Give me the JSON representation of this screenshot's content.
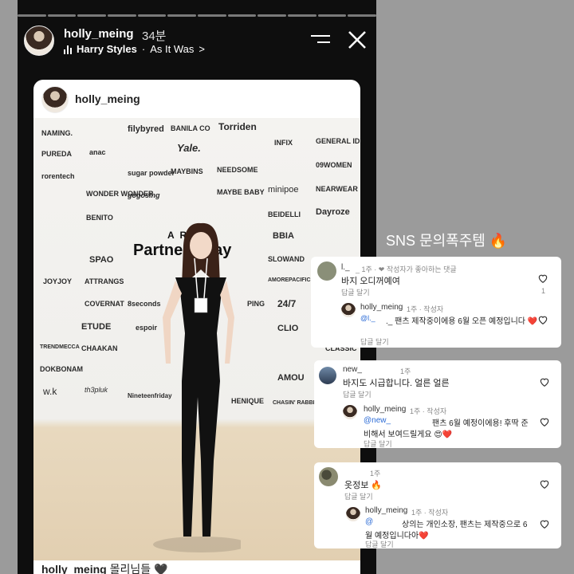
{
  "story": {
    "username": "holly_meing",
    "time": "34분",
    "music_artist": "Harry Styles",
    "music_sep": "·",
    "music_track": "As It Was",
    "music_chevron": ">"
  },
  "post": {
    "username": "holly_meing",
    "caption_user": "holly_meing",
    "caption_text": "몰리님들 🖤",
    "backdrop_title": "A RBY",
    "backdrop_main": "Partners Day",
    "logos": [
      "NAMING.",
      "filybyred",
      "BANILA CO",
      "Torriden",
      "GENERAL IDEA",
      "PUREDA",
      "anac",
      "Yale.",
      "INFIX",
      "rorentech",
      "sugar powder",
      "MAYBINS",
      "NEEDSOME",
      "09WOMEN",
      "WONDER WONDER",
      "gogosing",
      "MAYBE BABY",
      "minipoe",
      "NEARWEAR",
      "BENITO",
      "BEIDELLI",
      "Dayroze",
      "BBIA",
      "SPAO",
      "SLOWAND",
      "JOYJOY",
      "ATTRANGS",
      "AMOREPACIFIC",
      "COVERNAT",
      "8seconds",
      "PING",
      "24/7",
      "ETUDE",
      "espoir",
      "CLIO",
      "TRENDMECCA",
      "CHAAKAN",
      "CLASSIC",
      "DOKBONAM",
      "AMOU",
      "w.k",
      "th3pluk",
      "Nineteenfriday",
      "HENIQUE",
      "CHASIN' RABBITS"
    ]
  },
  "sns": {
    "title": "SNS 문의폭주템 🔥",
    "threads": [
      {
        "user": "l._",
        "extra": "_ 1주 · ❤ 작성자가 좋아하는 댓글",
        "text": "바지 오디꺼예여",
        "reply_label": "답글 달기",
        "like_count": "1",
        "reply": {
          "user": "holly_meing",
          "meta": "1주 · 작성자",
          "mention": "@l._",
          "text": "._ 팬츠 제작중이에용 6월 오픈 예정입니다 ❤️",
          "reply_label": "답글 달기"
        }
      },
      {
        "user": "new_",
        "extra": "1주",
        "text": "바지도 시급합니다. 얼른 얼른",
        "reply_label": "답글 달기",
        "reply": {
          "user": "holly_meing",
          "meta": "1주 · 작성자",
          "mention": "@new_",
          "text": "팬츠 6월 예정이에용! 후딱 준",
          "text2": "비해서 보여드릴게요 😍❤️",
          "reply_label": "답글 달기"
        }
      },
      {
        "user": "",
        "extra": "1주",
        "text": "옷정보 🔥",
        "reply_label": "답글 달기",
        "reply": {
          "user": "holly_meing",
          "meta": "1주 · 작성자",
          "mention": "@",
          "text": "상의는 개인소장, 팬츠는 제작중으로 6",
          "text2": "월 예정입니다아❤️",
          "reply_label": "답글 달기"
        }
      }
    ]
  },
  "colors": {
    "story_bg": "#0e0e0e",
    "page_bg": "#9b9b9b",
    "link": "#2b6bd6",
    "heart": "#e0245e"
  }
}
